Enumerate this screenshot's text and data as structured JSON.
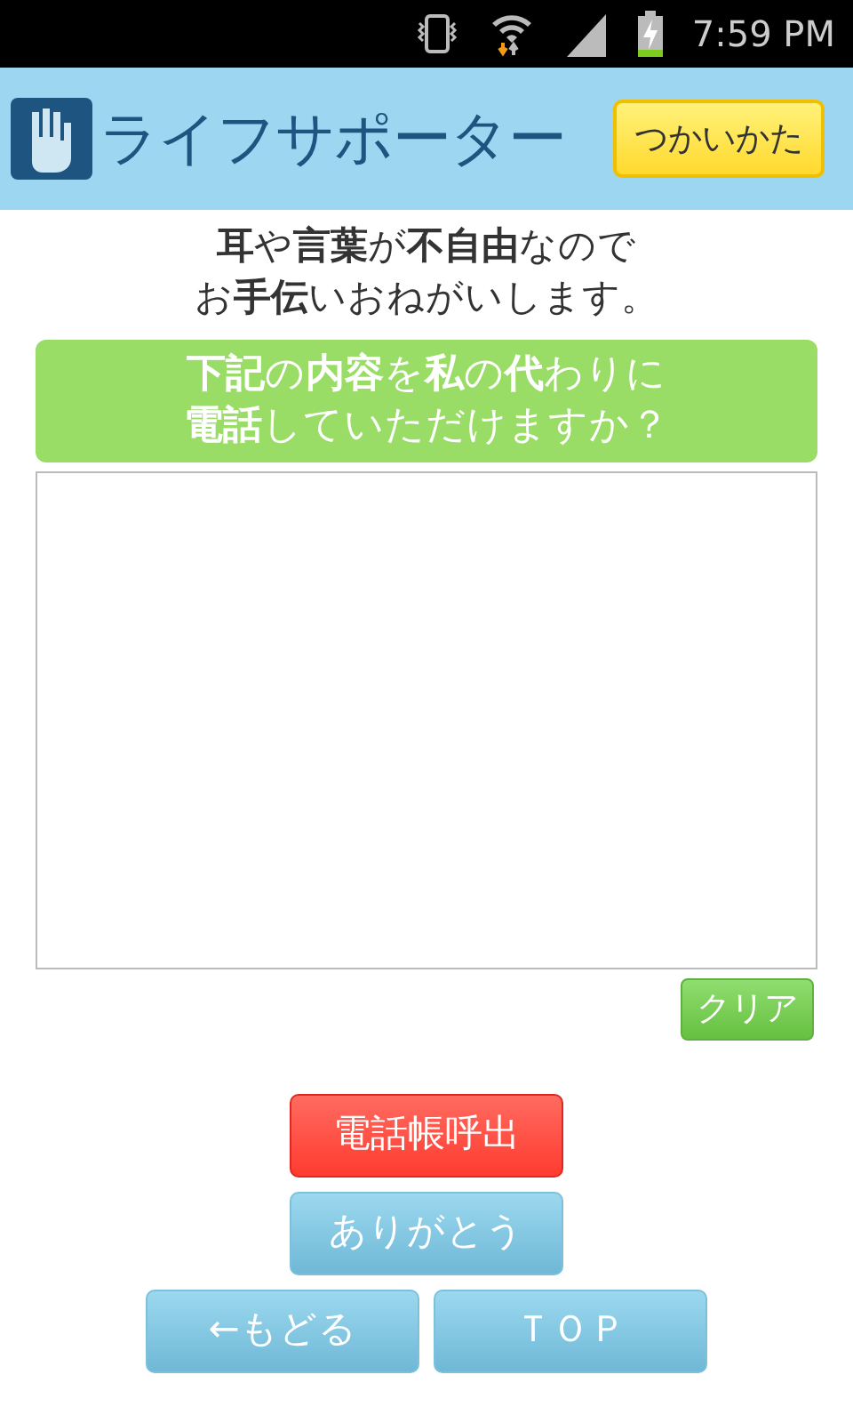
{
  "status_bar": {
    "time": "7:59 PM",
    "battery_charging": true
  },
  "header": {
    "app_name": "ライフサポーター",
    "help_button": "つかいかた"
  },
  "intro_lines": [
    "**耳**や**言葉**が**不自由**なので",
    "お**手伝**いおねがいします。"
  ],
  "request_banner_lines": [
    "**下記**の**内容**を**私**の**代**わりに",
    "**電話**していただけますか？"
  ],
  "clear_button": "クリア",
  "buttons": [
    {
      "label": "電話帳呼出",
      "kind": "red"
    },
    {
      "label": "ありがとう",
      "kind": "blue"
    }
  ],
  "bottom_buttons": [
    {
      "label": "←もどる",
      "kind": "blue"
    },
    {
      "label": "ＴＯＰ",
      "kind": "blue"
    }
  ]
}
